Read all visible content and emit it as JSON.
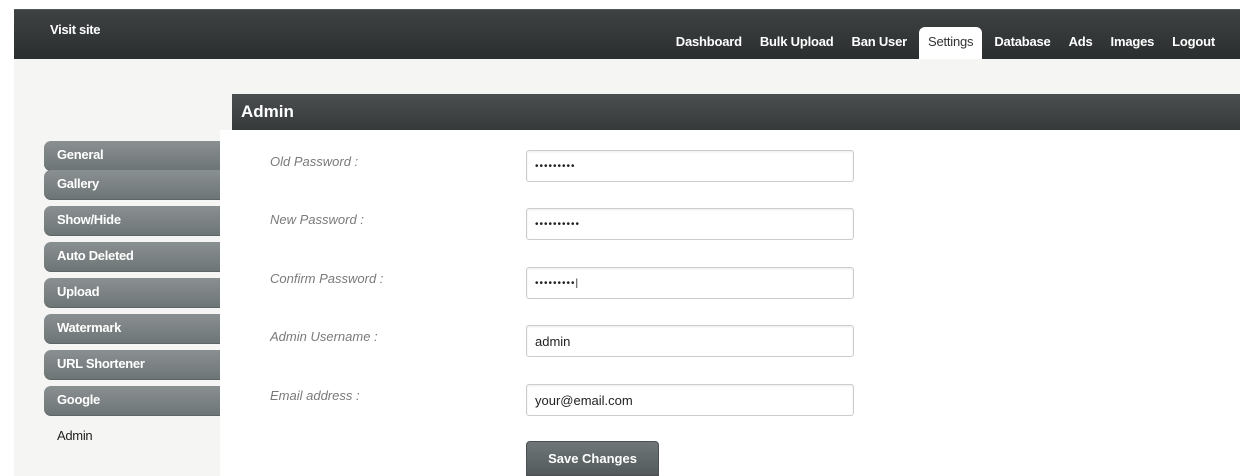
{
  "topbar": {
    "visit_link": "Visit site",
    "tabs": [
      {
        "label": "Dashboard"
      },
      {
        "label": "Bulk Upload"
      },
      {
        "label": "Ban User"
      },
      {
        "label": "Settings",
        "active": true
      },
      {
        "label": "Database"
      },
      {
        "label": "Ads"
      },
      {
        "label": "Images"
      },
      {
        "label": "Logout"
      }
    ]
  },
  "sidebar": {
    "items": [
      {
        "label": "General"
      },
      {
        "label": "Gallery"
      },
      {
        "label": "Show/Hide"
      },
      {
        "label": "Auto Deleted"
      },
      {
        "label": "Upload"
      },
      {
        "label": "Watermark"
      },
      {
        "label": "URL Shortener"
      },
      {
        "label": "Google"
      },
      {
        "label": "Admin",
        "active": true
      }
    ]
  },
  "panel": {
    "title": "Admin",
    "fields": [
      {
        "label": "Old Password :",
        "value": "•••••••••"
      },
      {
        "label": "New Password :",
        "value": "••••••••••"
      },
      {
        "label": "Confirm Password :",
        "value": "•••••••••|"
      },
      {
        "label": "Admin Username :",
        "value": "admin"
      },
      {
        "label": "Email address :",
        "value": "your@email.com"
      }
    ],
    "save_label": "Save Changes"
  },
  "colors": {
    "topbar": "#333637",
    "sidebar_tab": "#7b8182",
    "panel_header": "#3f4344",
    "page_bg": "#f5f6f4"
  }
}
